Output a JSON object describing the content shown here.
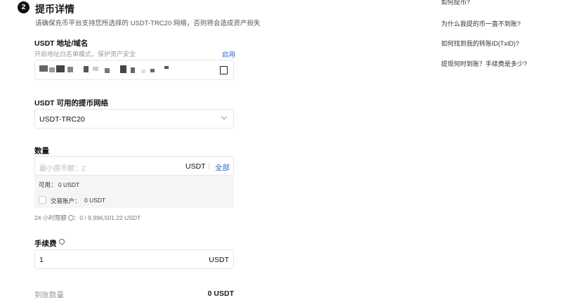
{
  "step": {
    "number": "2",
    "title": "提币详情",
    "subtitle": "请确保充币平台支持您所选择的 USDT-TRC20 网络，否则将会造成资产损失"
  },
  "address": {
    "label": "USDT 地址/域名",
    "hint": "开启地址白名单模式，保护资产安全",
    "enable_link": "启用",
    "icon": "address-book-icon"
  },
  "network": {
    "label": "USDT 可用的提币网络",
    "selected": "USDT-TRC20",
    "icon": "chevron-down-icon"
  },
  "amount": {
    "label": "数量",
    "placeholder": "最小提币额：2",
    "unit": "USDT",
    "all_button": "全部",
    "available": "可用： 0 USDT",
    "trading_account_label": "交易账户：",
    "trading_account_value": "0 USDT",
    "limit_label": "24 小时限额",
    "limit_value": "：0 / 9,996,501.22 USDT"
  },
  "fee": {
    "label": "手续费",
    "value": "1",
    "unit": "USDT"
  },
  "receive": {
    "label": "到账数量",
    "value": "0 USDT"
  },
  "faq": [
    "如何提币?",
    "为什么我提的币一直不到账?",
    "如何找到我的转账ID(TxID)?",
    "提现何时到账？手续费是多少?"
  ]
}
